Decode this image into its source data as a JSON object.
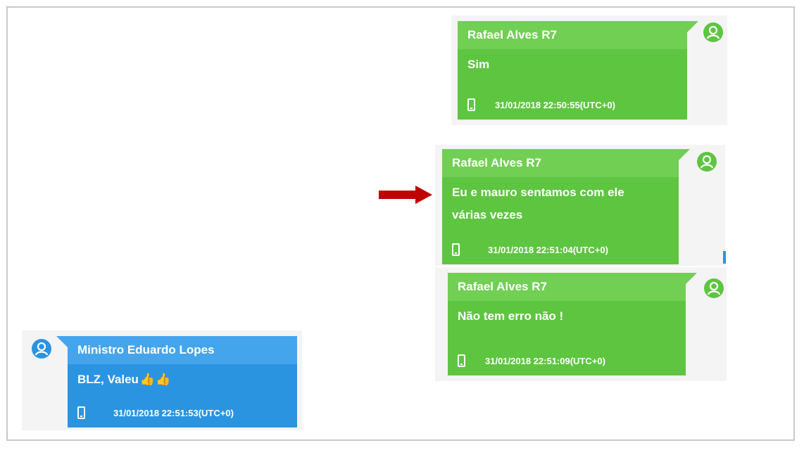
{
  "messages": [
    {
      "sender": "Rafael Alves R7",
      "text": "Sim",
      "timestamp": "31/01/2018 22:50:55(UTC+0)",
      "side": "right",
      "color": "#5ec540"
    },
    {
      "sender": "Rafael Alves R7",
      "text_line1": "Eu e mauro sentamos com ele",
      "text_line2": "várias vezes",
      "timestamp": "31/01/2018 22:51:04(UTC+0)",
      "side": "right",
      "color": "#5ec540",
      "highlighted_by": "red-arrow-icon"
    },
    {
      "sender": "Rafael Alves R7",
      "text": "Não tem erro não !",
      "timestamp": "31/01/2018 22:51:09(UTC+0)",
      "side": "right",
      "color": "#5ec540"
    },
    {
      "sender": "Ministro Eduardo Lopes",
      "text": "BLZ, Valeu",
      "emoji": "👍👍",
      "timestamp": "31/01/2018 22:51:53(UTC+0)",
      "side": "left",
      "color": "#2b94e0"
    }
  ],
  "icons": {
    "avatar": "user-avatar-icon",
    "device": "phone-icon",
    "pointer": "red-arrow-icon"
  },
  "colors": {
    "outgoing": "#5ec540",
    "outgoing_header": "#71cf54",
    "incoming": "#2b94e0",
    "incoming_header": "#45a5ec",
    "arrow": "#c00000"
  }
}
